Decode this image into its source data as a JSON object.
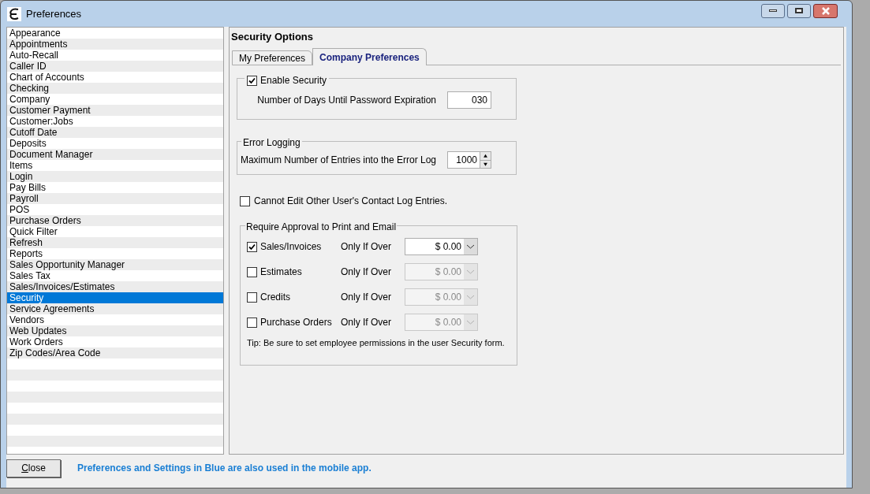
{
  "window": {
    "title": "Preferences"
  },
  "sidebar": {
    "items": [
      {
        "label": "Appearance",
        "selected": false
      },
      {
        "label": "Appointments",
        "selected": false
      },
      {
        "label": "Auto-Recall",
        "selected": false
      },
      {
        "label": "Caller ID",
        "selected": false
      },
      {
        "label": "Chart of Accounts",
        "selected": false
      },
      {
        "label": "Checking",
        "selected": false
      },
      {
        "label": "Company",
        "selected": false
      },
      {
        "label": "Customer Payment",
        "selected": false
      },
      {
        "label": "Customer:Jobs",
        "selected": false
      },
      {
        "label": "Cutoff Date",
        "selected": false
      },
      {
        "label": "Deposits",
        "selected": false
      },
      {
        "label": "Document Manager",
        "selected": false
      },
      {
        "label": "Items",
        "selected": false
      },
      {
        "label": "Login",
        "selected": false
      },
      {
        "label": "Pay Bills",
        "selected": false
      },
      {
        "label": "Payroll",
        "selected": false
      },
      {
        "label": "POS",
        "selected": false
      },
      {
        "label": "Purchase Orders",
        "selected": false
      },
      {
        "label": "Quick Filter",
        "selected": false
      },
      {
        "label": "Refresh",
        "selected": false
      },
      {
        "label": "Reports",
        "selected": false
      },
      {
        "label": "Sales Opportunity Manager",
        "selected": false
      },
      {
        "label": "Sales Tax",
        "selected": false
      },
      {
        "label": "Sales/Invoices/Estimates",
        "selected": false
      },
      {
        "label": "Security",
        "selected": true
      },
      {
        "label": "Service Agreements",
        "selected": false
      },
      {
        "label": "Vendors",
        "selected": false
      },
      {
        "label": "Web Updates",
        "selected": false
      },
      {
        "label": "Work Orders",
        "selected": false
      },
      {
        "label": "Zip Codes/Area Code",
        "selected": false
      }
    ]
  },
  "panel": {
    "title": "Security Options",
    "tabs": [
      {
        "label": "My Preferences",
        "selected": false
      },
      {
        "label": "Company Preferences",
        "selected": true
      }
    ],
    "enable_security": {
      "label": "Enable Security",
      "checked": true,
      "days_label": "Number of Days Until Password Expiration",
      "days_value": "030"
    },
    "error_logging": {
      "title": "Error Logging",
      "label": "Maximum Number of Entries into the Error Log",
      "value": "1000"
    },
    "contact_log": {
      "label": "Cannot Edit Other User's Contact Log Entries.",
      "checked": false
    },
    "approval": {
      "title": "Require Approval to Print and Email",
      "rows": [
        {
          "label": "Sales/Invoices",
          "checked": true,
          "condition": "Only If Over",
          "amount": "$ 0.00",
          "disabled": false
        },
        {
          "label": "Estimates",
          "checked": false,
          "condition": "Only If Over",
          "amount": "$ 0.00",
          "disabled": true
        },
        {
          "label": "Credits",
          "checked": false,
          "condition": "Only If Over",
          "amount": "$ 0.00",
          "disabled": true
        },
        {
          "label": "Purchase Orders",
          "checked": false,
          "condition": "Only If Over",
          "amount": "$ 0.00",
          "disabled": true
        }
      ],
      "tip": "Tip: Be sure to set employee permissions in the user Security form."
    }
  },
  "footer": {
    "close_button": "Close",
    "note": "Preferences and Settings in Blue are also used in the mobile app."
  }
}
